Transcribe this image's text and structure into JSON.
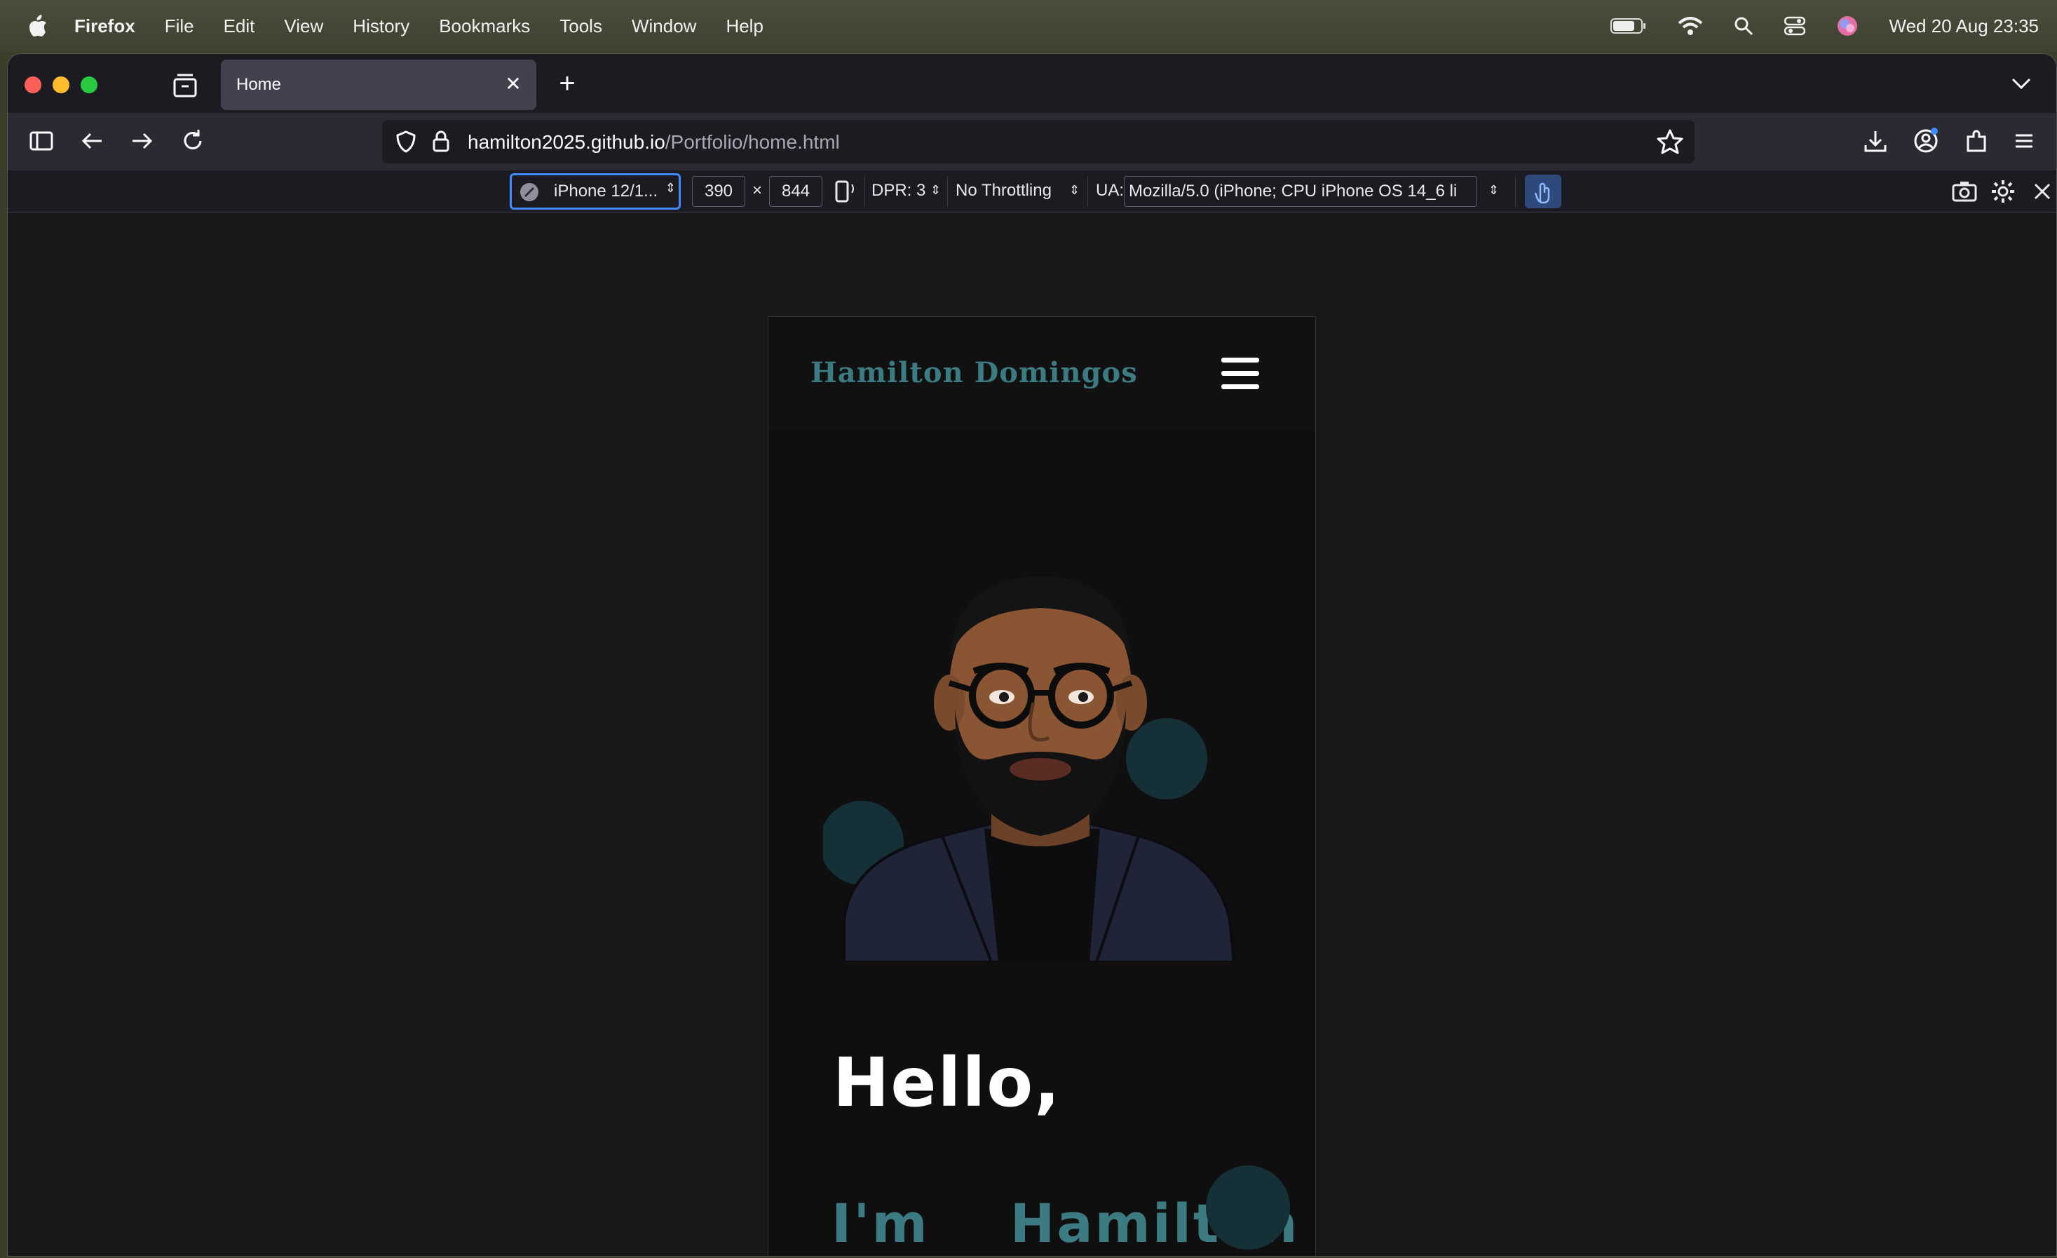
{
  "menubar": {
    "app": "Firefox",
    "items": [
      "File",
      "Edit",
      "View",
      "History",
      "Bookmarks",
      "Tools",
      "Window",
      "Help"
    ],
    "clock": "Wed 20 Aug  23:35"
  },
  "tab": {
    "title": "Home"
  },
  "navbar": {
    "url_host": "hamilton2025.github.io",
    "url_path": "/Portfolio/home.html"
  },
  "rdm": {
    "device": "iPhone 12/1...",
    "width": "390",
    "times": "×",
    "height": "844",
    "dpr": "DPR: 3",
    "throttling": "No Throttling",
    "ua_label": "UA:",
    "ua_value": "Mozilla/5.0 (iPhone; CPU iPhone OS 14_6 li"
  },
  "page": {
    "brand": "Hamilton Domingos",
    "hello": "Hello,",
    "im": "I'm",
    "name": "Hamilton"
  },
  "colors": {
    "accent_teal": "#3d7b82",
    "focus_blue": "#3e8cff",
    "tab_bg": "#42414d"
  }
}
